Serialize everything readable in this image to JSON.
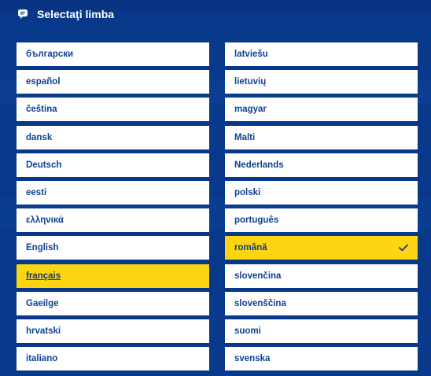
{
  "dialog": {
    "title": "Selectaţi limba",
    "icon": "chat-bubble-icon"
  },
  "languages": {
    "left": [
      {
        "label": "български",
        "state": "default"
      },
      {
        "label": "español",
        "state": "default"
      },
      {
        "label": "čeština",
        "state": "default"
      },
      {
        "label": "dansk",
        "state": "default"
      },
      {
        "label": "Deutsch",
        "state": "default"
      },
      {
        "label": "eesti",
        "state": "default"
      },
      {
        "label": "ελληνικά",
        "state": "default"
      },
      {
        "label": "English",
        "state": "default"
      },
      {
        "label": "français",
        "state": "highlighted"
      },
      {
        "label": "Gaeilge",
        "state": "default"
      },
      {
        "label": "hrvatski",
        "state": "default"
      },
      {
        "label": "italiano",
        "state": "default"
      }
    ],
    "right": [
      {
        "label": "latviešu",
        "state": "default"
      },
      {
        "label": "lietuvių",
        "state": "default"
      },
      {
        "label": "magyar",
        "state": "default"
      },
      {
        "label": "Malti",
        "state": "default"
      },
      {
        "label": "Nederlands",
        "state": "default"
      },
      {
        "label": "polski",
        "state": "default"
      },
      {
        "label": "português",
        "state": "default"
      },
      {
        "label": "română",
        "state": "selected"
      },
      {
        "label": "slovenčina",
        "state": "default"
      },
      {
        "label": "slovenščina",
        "state": "default"
      },
      {
        "label": "suomi",
        "state": "default"
      },
      {
        "label": "svenska",
        "state": "default"
      }
    ]
  },
  "colors": {
    "overlay": "#0a3d8f",
    "item_bg": "#ffffff",
    "item_text": "#0e4192",
    "highlight": "#fdd611"
  }
}
